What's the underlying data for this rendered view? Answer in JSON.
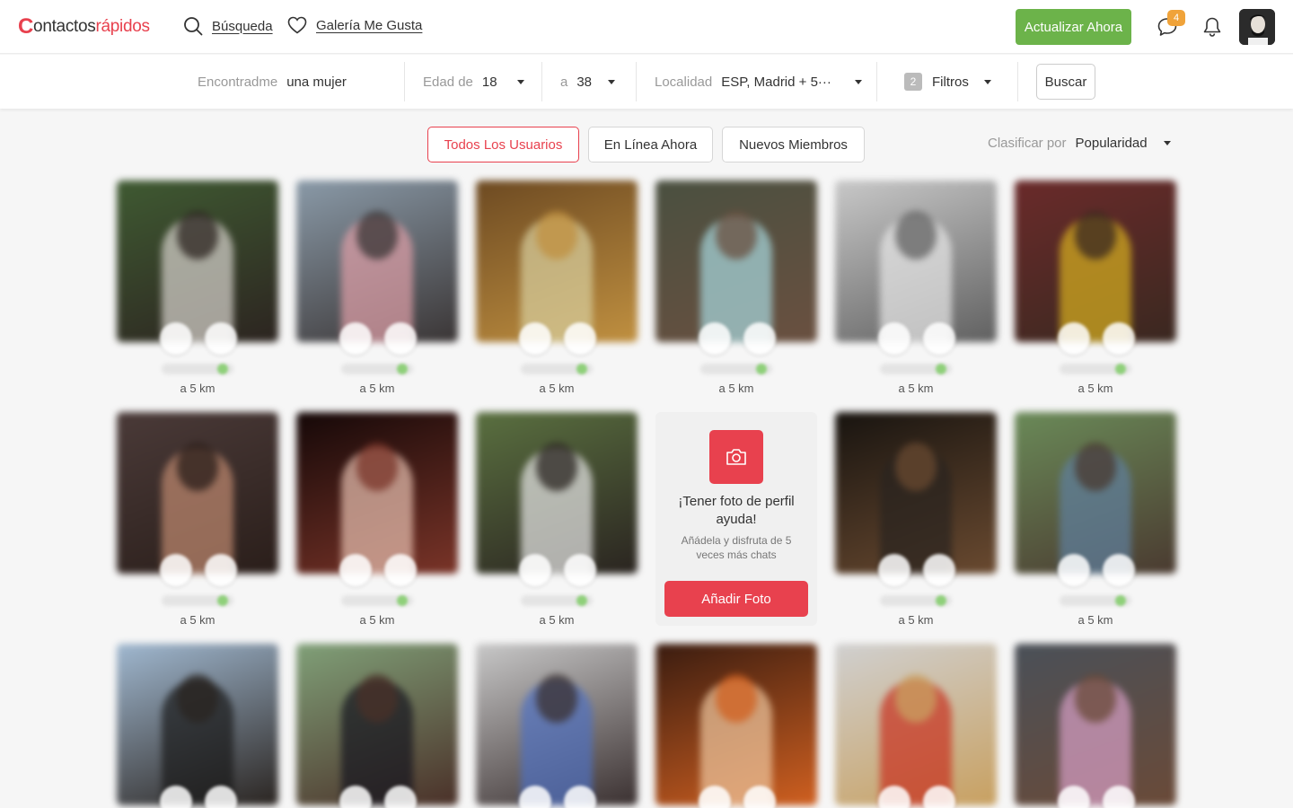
{
  "header": {
    "logo_first": "C",
    "logo_mid": "ontactos",
    "logo_end": "rápidos",
    "nav_search": "Búsqueda",
    "nav_likes": "Galería Me Gusta",
    "upgrade_label": "Actualizar Ahora",
    "messages_badge": "4"
  },
  "filters": {
    "seeking_label": "Encontradme",
    "seeking_value": "una mujer",
    "age_from_label": "Edad de",
    "age_from_value": "18",
    "age_to_label": "a",
    "age_to_value": "38",
    "location_label": "Localidad",
    "location_value": "ESP, Madrid + 5···",
    "filters_count": "2",
    "filters_label": "Filtros",
    "search_button": "Buscar"
  },
  "tabs": {
    "all_users": "Todos Los Usuarios",
    "online_now": "En Línea Ahora",
    "new_members": "Nuevos Miembros"
  },
  "sort": {
    "label": "Clasificar por",
    "value": "Popularidad"
  },
  "promo": {
    "title": "¡Tener foto de perfil ayuda!",
    "text": "Añádela y disfruta de 5 veces más chats",
    "button": "Añadir Foto"
  },
  "cards": [
    {
      "distance": "a 5 km",
      "palette": [
        "#3f5a32",
        "#2c2420",
        "#d8d4cf"
      ]
    },
    {
      "distance": "a 5 km",
      "palette": [
        "#8a9aa8",
        "#3a3535",
        "#e0a0a8"
      ]
    },
    {
      "distance": "a 5 km",
      "palette": [
        "#6d4a22",
        "#c09040",
        "#d8d0a0"
      ]
    },
    {
      "distance": "a 5 km",
      "palette": [
        "#4a5040",
        "#6a5040",
        "#a8d8e0"
      ]
    },
    {
      "distance": "a 5 km",
      "palette": [
        "#c8c8c8",
        "#606060",
        "#e8e8e8"
      ]
    },
    {
      "distance": "a 5 km",
      "palette": [
        "#6a2a2a",
        "#3a2820",
        "#d8b020"
      ]
    },
    {
      "distance": "a 5 km",
      "palette": [
        "#4a3a38",
        "#2a1e1a",
        "#c08a70"
      ]
    },
    {
      "distance": "a 5 km",
      "palette": [
        "#150808",
        "#7a3428",
        "#e8c0b0"
      ]
    },
    {
      "distance": "a 5 km",
      "palette": [
        "#5a7040",
        "#2a2420",
        "#e8e8e8"
      ]
    },
    {
      "distance": "a 5 km",
      "palette": [
        "#181410",
        "#6a4a30",
        "#2a2420"
      ]
    },
    {
      "distance": "a 5 km",
      "palette": [
        "#6a8a58",
        "#4a3a30",
        "#6080a0"
      ]
    },
    {
      "palette": [
        "#a0b8d0",
        "#2a2420",
        "#1a1a1a"
      ]
    },
    {
      "palette": [
        "#80a078",
        "#4a3028",
        "#151520"
      ]
    },
    {
      "palette": [
        "#c8c8c8",
        "#3a3030",
        "#5070c0"
      ]
    },
    {
      "palette": [
        "#3a1c10",
        "#d06020",
        "#f0c8a0"
      ]
    },
    {
      "palette": [
        "#d0d0d0",
        "#c8a060",
        "#c83020"
      ]
    },
    {
      "palette": [
        "#4a5058",
        "#6a4a38",
        "#d8a0c8"
      ]
    }
  ]
}
